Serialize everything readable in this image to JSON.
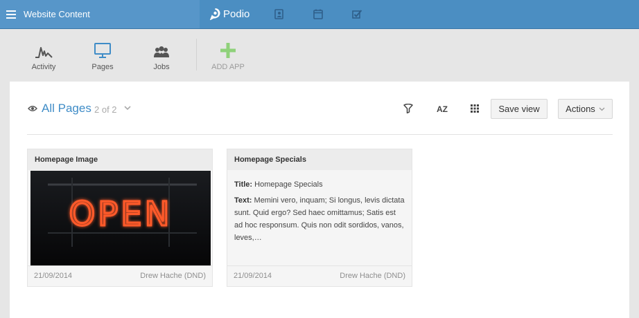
{
  "workspace": {
    "title": "Website Content"
  },
  "brand": {
    "name": "Podio"
  },
  "top_icons": [
    "contacts-icon",
    "calendar-icon",
    "tasks-icon"
  ],
  "apps": [
    {
      "label": "Activity",
      "icon": "activity-icon"
    },
    {
      "label": "Pages",
      "icon": "monitor-icon"
    },
    {
      "label": "Jobs",
      "icon": "people-icon"
    },
    {
      "label": "ADD APP",
      "icon": "plus-icon"
    }
  ],
  "view": {
    "title": "All Pages",
    "count": "2 of 2",
    "sort_label": "AZ",
    "save_label": "Save view",
    "actions_label": "Actions"
  },
  "cards": [
    {
      "title": "Homepage Image",
      "image_text": "OPEN",
      "date": "21/09/2014",
      "author": "Drew Hache (DND)"
    },
    {
      "title": "Homepage Specials",
      "field1_label": "Title:",
      "field1_value": "Homepage Specials",
      "field2_label": "Text:",
      "field2_value": "Memini vero, inquam; Si longus, levis dictata sunt. Quid ergo? Sed haec omittamus; Satis est ad hoc responsum. Quis non odit sordidos, vanos, leves,…",
      "date": "21/09/2014",
      "author": "Drew Hache (DND)"
    }
  ],
  "colors": {
    "topbar": "#4b8ec2",
    "workspace_bg": "#5796c9",
    "link_blue": "#3f8cc7",
    "add_green": "#8fd17a",
    "neon": "#ff5a2a"
  }
}
